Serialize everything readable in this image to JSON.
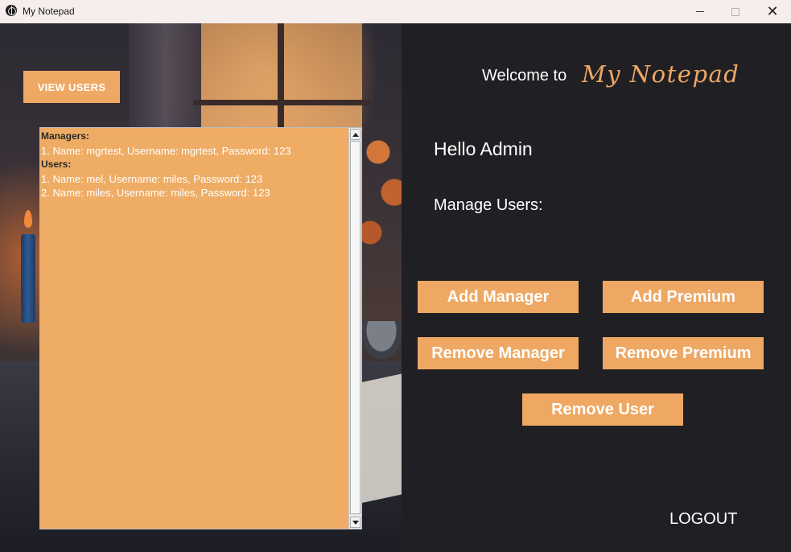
{
  "window": {
    "title": "My Notepad",
    "controls": [
      "minimize",
      "maximize",
      "close"
    ],
    "close_glyph": "✕"
  },
  "sidebar": {
    "view_users_label": "VIEW USERS",
    "users_text": {
      "managers_header": "Managers:",
      "managers": [
        "1. Name: mgrtest, Username: mgrtest, Password: 123"
      ],
      "users_header": "Users:",
      "users": [
        "1. Name: mel, Username: miles, Password: 123",
        "2. Name: miles, Username: miles, Password: 123"
      ]
    }
  },
  "main": {
    "welcome_text": "Welcome to",
    "brand_text": "My Notepad",
    "greeting": "Hello Admin",
    "section_label": "Manage Users:",
    "buttons": {
      "add_manager": "Add Manager",
      "add_premium": "Add Premium",
      "remove_manager": "Remove Manager",
      "remove_premium": "Remove Premium",
      "remove_user": "Remove User"
    },
    "logout_label": "LOGOUT"
  },
  "colors": {
    "accent": "#eea863",
    "panel_dark": "#202024",
    "titlebar": "#f6eded",
    "text_light": "#ffffff"
  }
}
